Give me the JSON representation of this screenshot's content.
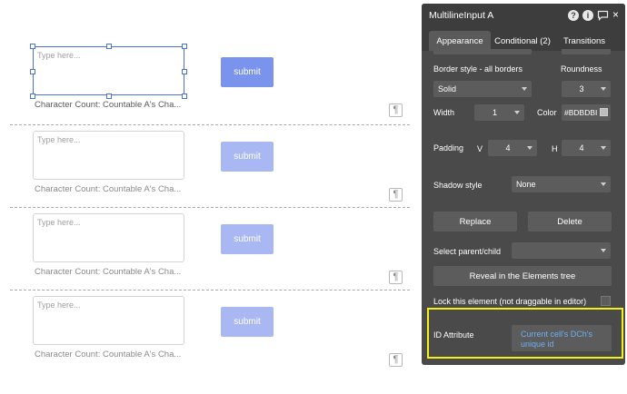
{
  "canvas": {
    "input_placeholder": "Type here...",
    "submit_label": "submit",
    "char_count_text": "Character Count: Countable A's Cha...",
    "paragraph_icon": "pilcrow-icon",
    "paragraph_glyph": "¶"
  },
  "panel": {
    "title": "MultilineInput A",
    "header_icons": [
      "help-icon",
      "info-icon",
      "comment-icon",
      "close-icon"
    ],
    "header_icon_glyphs": {
      "help": "?",
      "info": "i",
      "close": "×"
    },
    "tabs": [
      {
        "label": "Appearance",
        "active": true
      },
      {
        "label": "Conditional (2)",
        "active": false
      },
      {
        "label": "Transitions",
        "active": false
      }
    ],
    "border_style_label": "Border style - all borders",
    "roundness_label": "Roundness",
    "border_style_value": "Solid",
    "roundness_value": "3",
    "width_label": "Width",
    "width_value": "1",
    "color_label": "Color",
    "color_value": "#BDBDBI",
    "color_swatch": "#bdbdbd",
    "padding_label": "Padding",
    "padding_v_label": "V",
    "padding_v_value": "4",
    "padding_h_label": "H",
    "padding_h_value": "4",
    "shadow_label": "Shadow style",
    "shadow_value": "None",
    "replace_label": "Replace",
    "delete_label": "Delete",
    "select_parent_label": "Select parent/child",
    "select_parent_value": "",
    "reveal_label": "Reveal in the Elements tree",
    "lock_label": "Lock this element (not draggable in editor)",
    "id_attr_label": "ID Attribute",
    "id_attr_value": "Current cell's DCh's unique id",
    "highlight_color": "#f4f01a"
  }
}
